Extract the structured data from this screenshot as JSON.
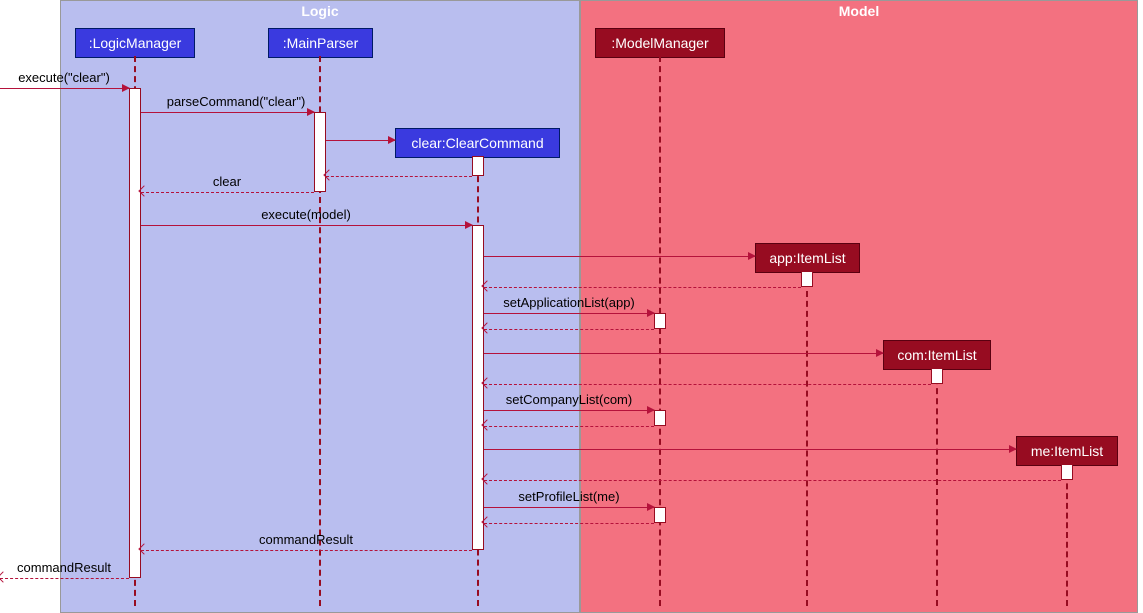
{
  "regions": {
    "logic": {
      "title": "Logic"
    },
    "model": {
      "title": "Model"
    }
  },
  "participants": {
    "logicManager": ":LogicManager",
    "mainParser": ":MainParser",
    "clearCommand": "clear:ClearCommand",
    "modelManager": ":ModelManager",
    "appItemList": "app:ItemList",
    "comItemList": "com:ItemList",
    "meItemList": "me:ItemList"
  },
  "messages": {
    "m1": "execute(\"clear\")",
    "m2": "parseCommand(\"clear\")",
    "m3_return": "clear",
    "m4": "execute(model)",
    "m5": "setApplicationList(app)",
    "m6": "setCompanyList(com)",
    "m7": "setProfileList(me)",
    "m8_return": "commandResult",
    "m9_return": "commandResult"
  },
  "chart_data": {
    "type": "sequence-diagram",
    "regions": [
      {
        "name": "Logic",
        "participants": [
          ":LogicManager",
          ":MainParser",
          "clear:ClearCommand"
        ]
      },
      {
        "name": "Model",
        "participants": [
          ":ModelManager",
          "app:ItemList",
          "com:ItemList",
          "me:ItemList"
        ]
      }
    ],
    "messages": [
      {
        "from": "caller",
        "to": ":LogicManager",
        "label": "execute(\"clear\")",
        "kind": "sync"
      },
      {
        "from": ":LogicManager",
        "to": ":MainParser",
        "label": "parseCommand(\"clear\")",
        "kind": "sync"
      },
      {
        "from": ":MainParser",
        "to": "clear:ClearCommand",
        "label": "",
        "kind": "create"
      },
      {
        "from": "clear:ClearCommand",
        "to": ":MainParser",
        "label": "",
        "kind": "return"
      },
      {
        "from": ":MainParser",
        "to": ":LogicManager",
        "label": "clear",
        "kind": "return"
      },
      {
        "from": ":LogicManager",
        "to": "clear:ClearCommand",
        "label": "execute(model)",
        "kind": "sync"
      },
      {
        "from": "clear:ClearCommand",
        "to": "app:ItemList",
        "label": "",
        "kind": "create"
      },
      {
        "from": "app:ItemList",
        "to": "clear:ClearCommand",
        "label": "",
        "kind": "return"
      },
      {
        "from": "clear:ClearCommand",
        "to": ":ModelManager",
        "label": "setApplicationList(app)",
        "kind": "sync"
      },
      {
        "from": ":ModelManager",
        "to": "clear:ClearCommand",
        "label": "",
        "kind": "return"
      },
      {
        "from": "clear:ClearCommand",
        "to": "com:ItemList",
        "label": "",
        "kind": "create"
      },
      {
        "from": "com:ItemList",
        "to": "clear:ClearCommand",
        "label": "",
        "kind": "return"
      },
      {
        "from": "clear:ClearCommand",
        "to": ":ModelManager",
        "label": "setCompanyList(com)",
        "kind": "sync"
      },
      {
        "from": ":ModelManager",
        "to": "clear:ClearCommand",
        "label": "",
        "kind": "return"
      },
      {
        "from": "clear:ClearCommand",
        "to": "me:ItemList",
        "label": "",
        "kind": "create"
      },
      {
        "from": "me:ItemList",
        "to": "clear:ClearCommand",
        "label": "",
        "kind": "return"
      },
      {
        "from": "clear:ClearCommand",
        "to": ":ModelManager",
        "label": "setProfileList(me)",
        "kind": "sync"
      },
      {
        "from": ":ModelManager",
        "to": "clear:ClearCommand",
        "label": "",
        "kind": "return"
      },
      {
        "from": "clear:ClearCommand",
        "to": ":LogicManager",
        "label": "commandResult",
        "kind": "return"
      },
      {
        "from": ":LogicManager",
        "to": "caller",
        "label": "commandResult",
        "kind": "return"
      }
    ]
  }
}
